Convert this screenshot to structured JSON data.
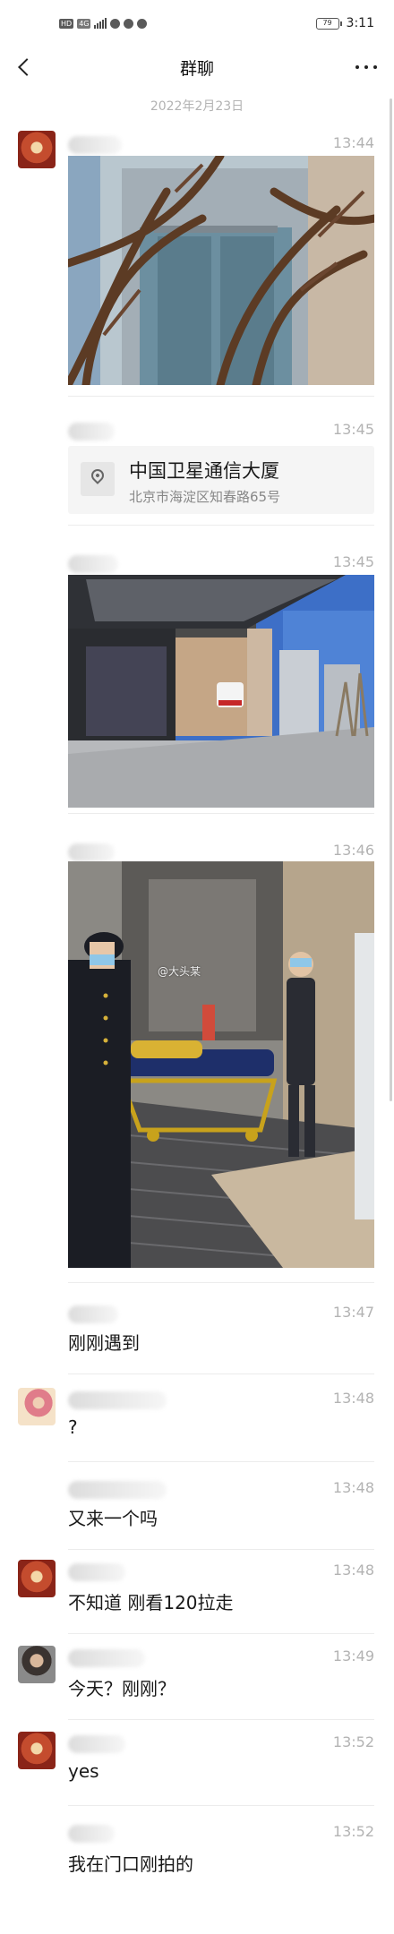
{
  "status_bar": {
    "network_chip": "HD",
    "network_gen": "4G",
    "battery": "79",
    "time": "3:11"
  },
  "header": {
    "title": "群聊",
    "date_separator": "2022年2月23日"
  },
  "colors": {
    "accent": "#07c160",
    "background": "#ffffff",
    "timestamp": "#b3b3b3"
  },
  "icons": {
    "back": "chevron-left-icon",
    "more": "more-dots-icon",
    "location": "location-pin-icon"
  },
  "messages": [
    {
      "time": "13:44",
      "type": "image",
      "content": ""
    },
    {
      "time": "13:45",
      "type": "location",
      "name": "中国卫星通信大厦",
      "address": "北京市海淀区知春路65号"
    },
    {
      "time": "13:45",
      "type": "image",
      "content": ""
    },
    {
      "time": "13:46",
      "type": "image",
      "content": "",
      "watermark": "@大头某"
    },
    {
      "time": "13:47",
      "type": "text",
      "content": "刚刚遇到"
    },
    {
      "time": "13:48",
      "type": "text",
      "content": "?"
    },
    {
      "time": "13:48",
      "type": "text",
      "content": "又来一个吗"
    },
    {
      "time": "13:48",
      "type": "text",
      "content": "不知道 刚看120拉走"
    },
    {
      "time": "13:49",
      "type": "text",
      "content": "今天？刚刚？"
    },
    {
      "time": "13:52",
      "type": "text",
      "content": "yes"
    },
    {
      "time": "13:52",
      "type": "text",
      "content": "我在门口刚拍的"
    }
  ]
}
